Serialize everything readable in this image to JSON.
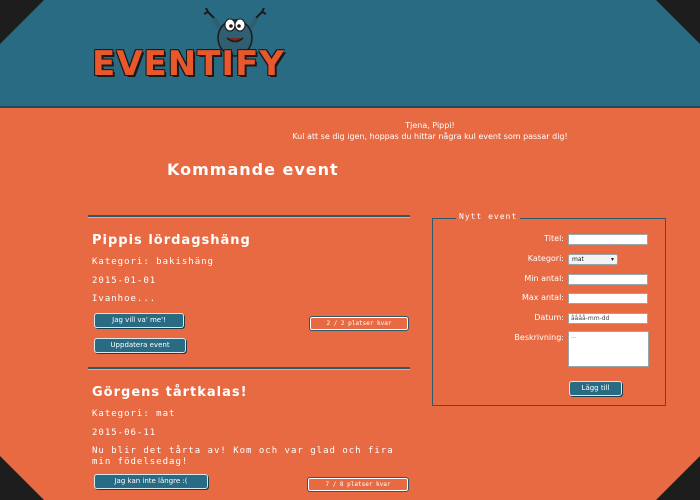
{
  "header": {
    "logo_text": "EVENTIFY"
  },
  "greeting": {
    "line1": "Tjena, Pippi!",
    "line2": "Kul att se dig igen, hoppas du hittar några kul event som passar dig!"
  },
  "main": {
    "title": "Kommande event",
    "events": [
      {
        "title": "Pippis lördagshäng",
        "category": "Kategori: bakishäng",
        "date": "2015-01-01",
        "description": "Ivanhoe...",
        "primary_button": "Jag vill va' me'!",
        "secondary_button": "Uppdatera event",
        "spots": "2 / 2 platser kvar"
      },
      {
        "title": "Görgens tårtkalas!",
        "category": "Kategori: mat",
        "date": "2015-06-11",
        "description": "Nu blir det tårta av! Kom och var glad och fira min födelsedag!",
        "primary_button": "Jag kan inte längre :(",
        "spots": "7 / 8 platser kvar"
      }
    ]
  },
  "new_event": {
    "legend": "Nytt event",
    "title_label": "Titel:",
    "title_value": "",
    "category_label": "Kategori:",
    "category_selected": "mat",
    "min_label": "Min antal:",
    "min_value": "",
    "max_label": "Max antal:",
    "max_value": "",
    "date_label": "Datum:",
    "date_placeholder": "åååå-mm-dd",
    "desc_label": "Beskrivning:",
    "desc_placeholder": "...",
    "submit_label": "Lägg till"
  },
  "colors": {
    "background": "#e86a43",
    "header": "#2a6b84",
    "button": "#2a6b84"
  }
}
